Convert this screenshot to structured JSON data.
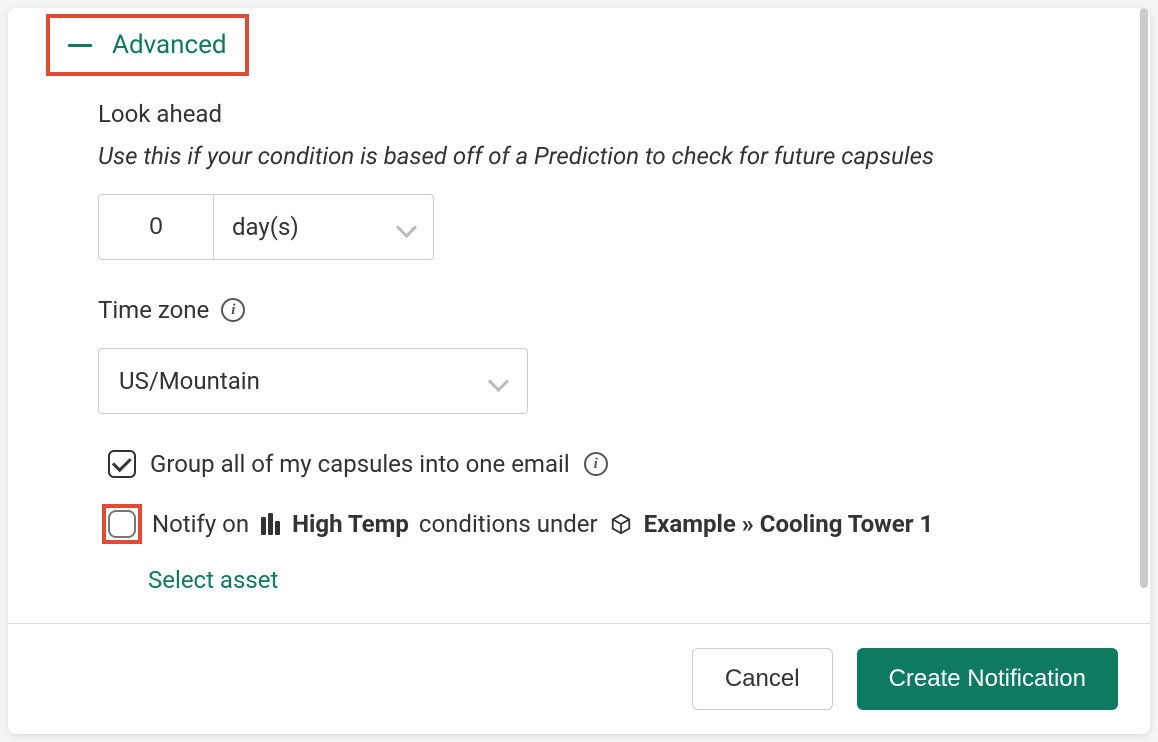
{
  "advanced": {
    "label": "Advanced"
  },
  "lookAhead": {
    "label": "Look ahead",
    "hint": "Use this if your condition is based off of a Prediction to check for future capsules",
    "value": "0",
    "unit": "day(s)"
  },
  "timezone": {
    "label": "Time zone",
    "value": "US/Mountain"
  },
  "groupCapsules": {
    "checked": true,
    "label": "Group all of my capsules into one email"
  },
  "notify": {
    "checked": false,
    "prefix": "Notify on",
    "condition": "High Temp",
    "mid": "conditions under",
    "asset": "Example » Cooling Tower 1",
    "selectAsset": "Select asset"
  },
  "footer": {
    "cancel": "Cancel",
    "create": "Create Notification"
  }
}
